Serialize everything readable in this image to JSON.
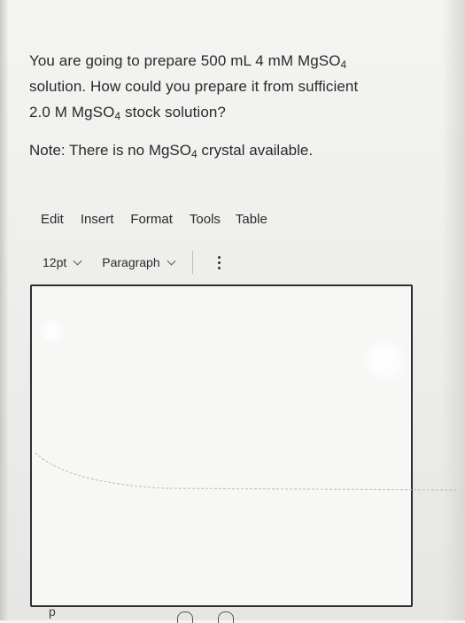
{
  "question": {
    "line1": "You are going to prepare 500 mL 4 mM MgSO",
    "line1_sub": "4",
    "line2": "solution. How could you prepare it from sufficient",
    "line3_pre": "2.0 M MgSO",
    "line3_sub": "4",
    "line3_post": " stock solution?"
  },
  "note": {
    "pre": "Note: There is no MgSO",
    "sub": "4",
    "post": " crystal available."
  },
  "menu": {
    "edit": "Edit",
    "insert": "Insert",
    "format": "Format",
    "tools": "Tools",
    "table": "Table"
  },
  "toolbar": {
    "font_size": "12pt",
    "block_format": "Paragraph"
  },
  "editor": {
    "content": ""
  },
  "statusbar": {
    "path": "p"
  }
}
